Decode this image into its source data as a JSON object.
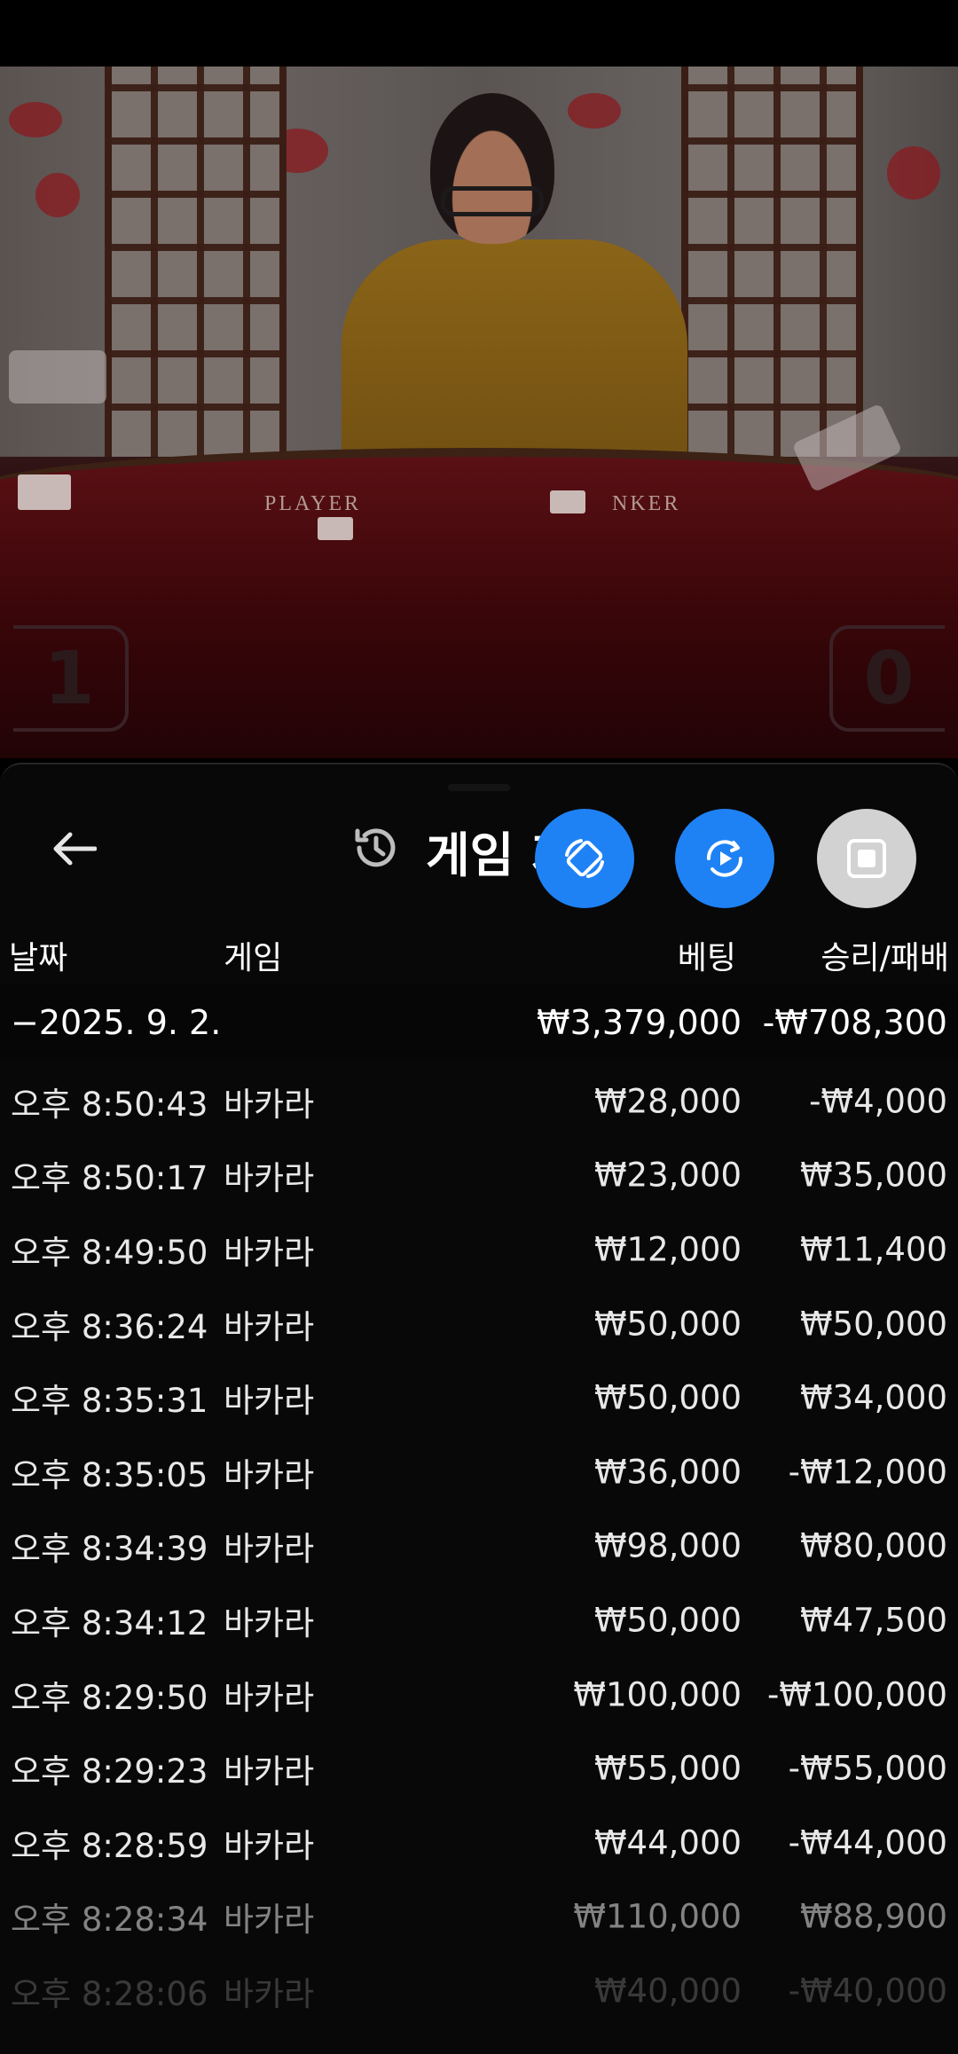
{
  "video": {
    "table_labels": {
      "player": "PLAYER",
      "banker": "NKER"
    },
    "score_left": "1",
    "score_right": "0"
  },
  "panel": {
    "title": "게임 기록",
    "back_icon": "arrow-left-icon",
    "history_icon": "history-icon",
    "fab_icons": [
      "screen-rotate-icon",
      "screen-record-icon",
      "stop-icon"
    ],
    "colors": {
      "accent": "#1e82f5",
      "stop": "#d2d2d2",
      "background": "#080808"
    }
  },
  "columns": {
    "date": "날짜",
    "game": "게임",
    "bet": "베팅",
    "win_loss": "승리/패배"
  },
  "summary": {
    "date": "−2025. 9. 2.",
    "bet": "₩3,379,000",
    "win_loss": "-₩708,300"
  },
  "rows": [
    {
      "time": "오후 8:50:43",
      "game": "바카라",
      "bet": "₩28,000",
      "win_loss": "-₩4,000"
    },
    {
      "time": "오후 8:50:17",
      "game": "바카라",
      "bet": "₩23,000",
      "win_loss": "₩35,000"
    },
    {
      "time": "오후 8:49:50",
      "game": "바카라",
      "bet": "₩12,000",
      "win_loss": "₩11,400"
    },
    {
      "time": "오후 8:36:24",
      "game": "바카라",
      "bet": "₩50,000",
      "win_loss": "₩50,000"
    },
    {
      "time": "오후 8:35:31",
      "game": "바카라",
      "bet": "₩50,000",
      "win_loss": "₩34,000"
    },
    {
      "time": "오후 8:35:05",
      "game": "바카라",
      "bet": "₩36,000",
      "win_loss": "-₩12,000"
    },
    {
      "time": "오후 8:34:39",
      "game": "바카라",
      "bet": "₩98,000",
      "win_loss": "₩80,000"
    },
    {
      "time": "오후 8:34:12",
      "game": "바카라",
      "bet": "₩50,000",
      "win_loss": "₩47,500"
    },
    {
      "time": "오후 8:29:50",
      "game": "바카라",
      "bet": "₩100,000",
      "win_loss": "-₩100,000"
    },
    {
      "time": "오후 8:29:23",
      "game": "바카라",
      "bet": "₩55,000",
      "win_loss": "-₩55,000"
    },
    {
      "time": "오후 8:28:59",
      "game": "바카라",
      "bet": "₩44,000",
      "win_loss": "-₩44,000"
    },
    {
      "time": "오후 8:28:34",
      "game": "바카라",
      "bet": "₩110,000",
      "win_loss": "₩88,900"
    },
    {
      "time": "오후 8:28:06",
      "game": "바카라",
      "bet": "₩40,000",
      "win_loss": "-₩40,000"
    }
  ]
}
